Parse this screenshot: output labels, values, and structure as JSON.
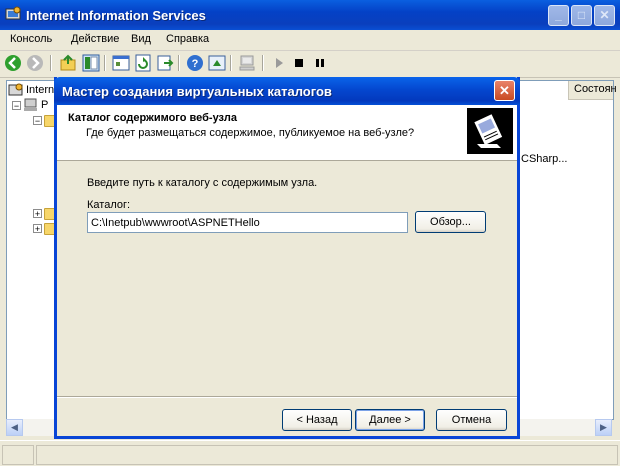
{
  "main_window": {
    "title": "Internet Information Services",
    "menu": [
      "Консоль",
      "Действие",
      "Вид",
      "Справка"
    ],
    "tree_root": "Intern",
    "tree_item": "Р",
    "column_header": "Состоян",
    "list_fragment": "CSharp..."
  },
  "dialog": {
    "title": "Мастер создания виртуальных каталогов",
    "header_title": "Каталог содержимого веб-узла",
    "header_subtitle": "Где будет размещаться содержимое, публикуемое на веб-узле?",
    "prompt": "Введите путь к каталогу с содержимым узла.",
    "field_label": "Каталог:",
    "field_value": "C:\\Inetpub\\wwwroot\\ASPNETHello",
    "browse_label": "Обзор...",
    "back_label": "< Назад",
    "next_label": "Далее >",
    "cancel_label": "Отмена"
  },
  "colors": {
    "titlebar": "#0a4fd4",
    "window_bg": "#ece9d8",
    "close_red": "#c94a22"
  },
  "icons": [
    "back-icon",
    "forward-icon",
    "up-icon",
    "show-tree-icon",
    "properties-icon",
    "refresh-icon",
    "export-icon",
    "help-icon",
    "computer-icon",
    "play-icon",
    "stop-icon",
    "pause-icon",
    "wizard-icon"
  ]
}
